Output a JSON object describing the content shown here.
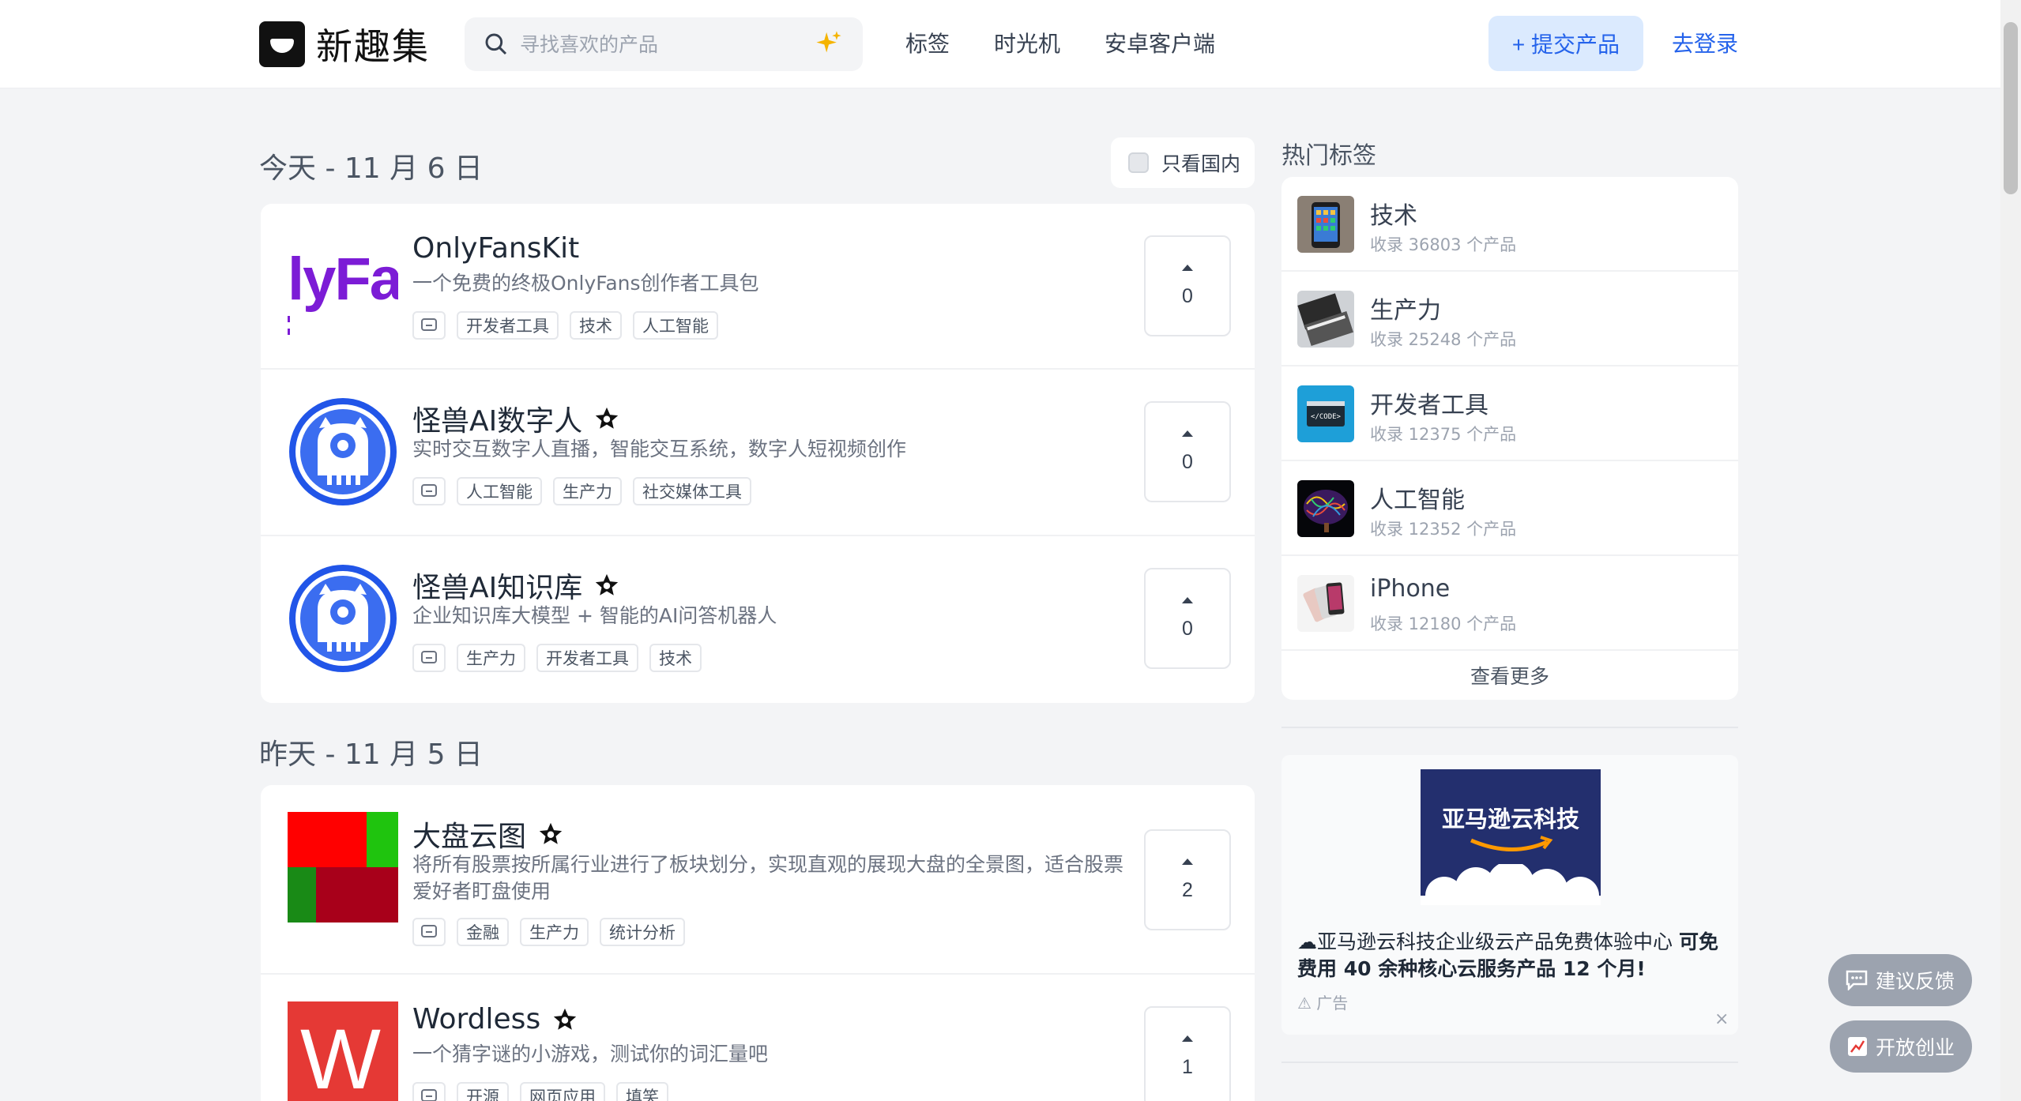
{
  "header": {
    "logo_text": "新趣集",
    "search_placeholder": "寻找喜欢的产品",
    "nav": [
      "标签",
      "时光机",
      "安卓客户端"
    ],
    "submit_label": "+ 提交产品",
    "login_label": "去登录"
  },
  "today": {
    "title": "今天 - 11 月 6 日",
    "domestic_toggle": "只看国内",
    "items": [
      {
        "name": "OnlyFansKit",
        "desc": "一个免费的终极OnlyFans创作者工具包",
        "tags": [
          "开发者工具",
          "技术",
          "人工智能"
        ],
        "votes": "0",
        "thumb_text": "lyFa"
      },
      {
        "name": "怪兽AI数字人",
        "desc": "实时交互数字人直播，智能交互系统，数字人短视频创作",
        "tags": [
          "人工智能",
          "生产力",
          "社交媒体工具"
        ],
        "votes": "0"
      },
      {
        "name": "怪兽AI知识库",
        "desc": "企业知识库大模型 + 智能的AI问答机器人",
        "tags": [
          "生产力",
          "开发者工具",
          "技术"
        ],
        "votes": "0"
      }
    ]
  },
  "yesterday": {
    "title": "昨天 - 11 月 5 日",
    "items": [
      {
        "name": "大盘云图",
        "desc": "将所有股票按所属行业进行了板块划分，实现直观的展现大盘的全景图，适合股票爱好者盯盘使用",
        "tags": [
          "金融",
          "生产力",
          "统计分析"
        ],
        "votes": "2"
      },
      {
        "name": "Wordless",
        "desc": "一个猜字谜的小游戏，测试你的词汇量吧",
        "tags": [
          "开源",
          "网页应用",
          "填笑"
        ],
        "votes": "1",
        "thumb_text": "W"
      }
    ]
  },
  "sidebar": {
    "hot_title": "热门标签",
    "hot_tags": [
      {
        "name": "技术",
        "count": "收录 36803 个产品"
      },
      {
        "name": "生产力",
        "count": "收录 25248 个产品"
      },
      {
        "name": "开发者工具",
        "count": "收录 12375 个产品"
      },
      {
        "name": "人工智能",
        "count": "收录 12352 个产品"
      },
      {
        "name": "iPhone",
        "count": "收录 12180 个产品"
      }
    ],
    "more_label": "查看更多",
    "ad": {
      "banner_text": "亚马逊云科技",
      "text_plain": "☁亚马逊云科技企业级云产品免费体验中心 ",
      "text_bold": "可免费用 40 余种核心云服务产品 12 个月!",
      "label": "广告",
      "close": "×"
    }
  },
  "floating": {
    "feedback_label": "建议反馈",
    "startup_label": "开放创业"
  },
  "colors": {
    "accent": "#2563eb",
    "accent_bg": "#dbeafe",
    "background": "#f3f4f6"
  }
}
